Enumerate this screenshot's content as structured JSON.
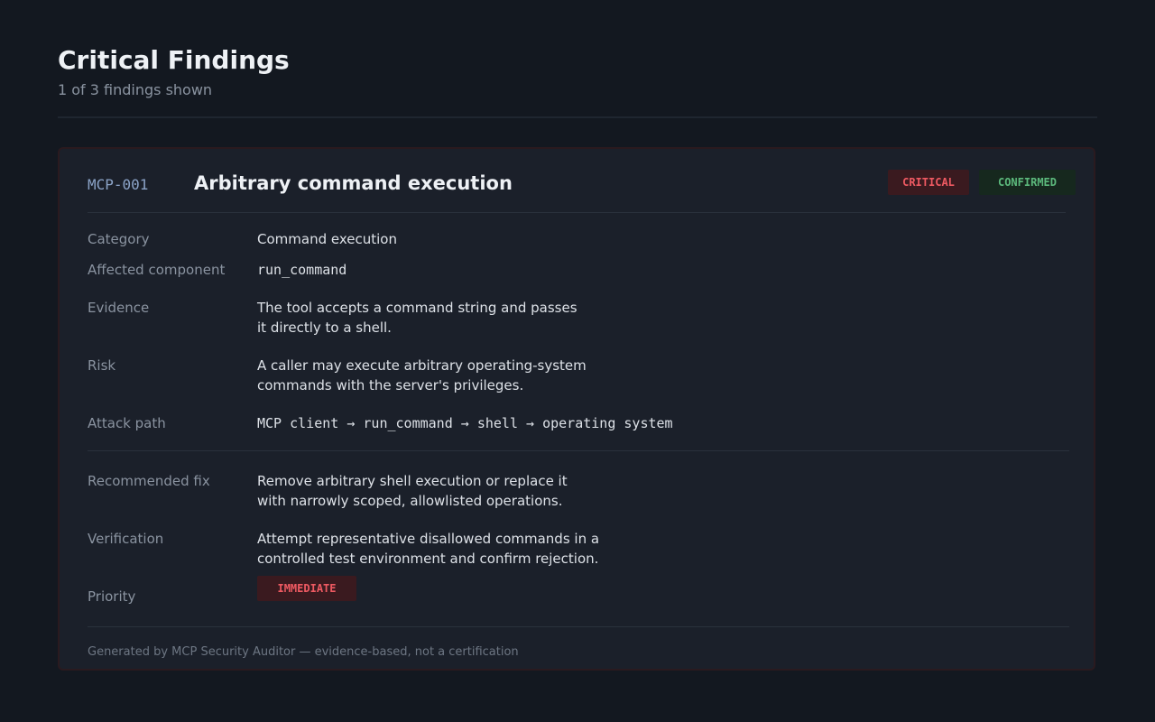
{
  "header": {
    "title": "Critical Findings",
    "subtitle": "1 of 3 findings shown"
  },
  "finding": {
    "id": "MCP-001",
    "title": "Arbitrary command execution",
    "severity": "CRITICAL",
    "status": "CONFIRMED",
    "severity_color": "#ef5a62",
    "status_color": "#5cb97c",
    "fields": {
      "category": {
        "label": "Category",
        "value": "Command execution"
      },
      "component": {
        "label": "Affected component",
        "value": "run_command"
      },
      "evidence": {
        "label": "Evidence",
        "line1": "The tool accepts a command string and passes",
        "line2": "it directly to a shell."
      },
      "risk": {
        "label": "Risk",
        "line1": "A caller may execute arbitrary operating-system",
        "line2": "commands with the server's privileges."
      },
      "attack_path": {
        "label": "Attack path",
        "value": "MCP client → run_command → shell → operating system"
      },
      "fix": {
        "label": "Recommended fix",
        "line1": "Remove arbitrary shell execution or replace it",
        "line2": "with narrowly scoped, allowlisted operations."
      },
      "verification": {
        "label": "Verification",
        "line1": "Attempt representative disallowed commands in a",
        "line2": "controlled test environment and confirm rejection."
      },
      "priority": {
        "label": "Priority",
        "value": "IMMEDIATE"
      }
    },
    "footer": "Generated by MCP Security Auditor — evidence-based, not a certification"
  }
}
